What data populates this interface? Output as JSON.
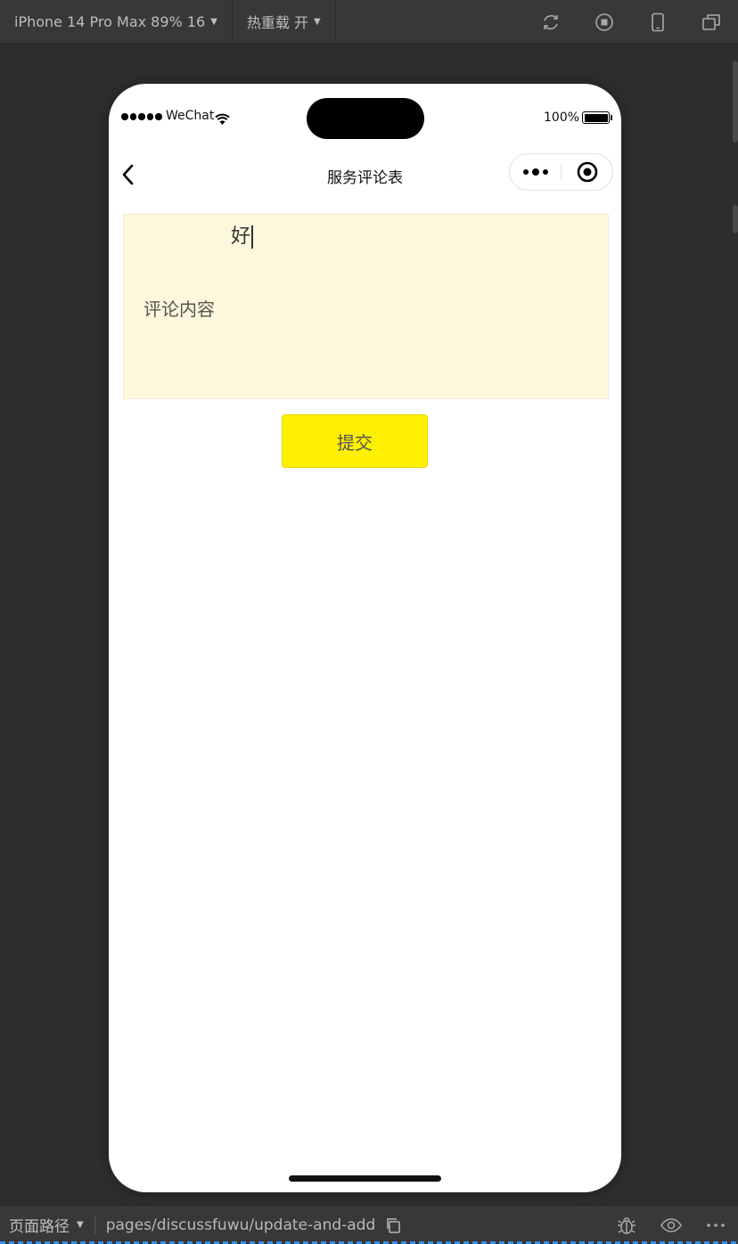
{
  "toolbar": {
    "device_label": "iPhone 14 Pro Max 89% 16",
    "hot_reload_label": "热重载 开",
    "icons": [
      "refresh-icon",
      "stop-icon",
      "phone-icon",
      "window-icon"
    ]
  },
  "phone": {
    "status": {
      "carrier": "WeChat",
      "battery": "100%"
    },
    "nav": {
      "title": "服务评论表"
    },
    "form": {
      "input_value": "好",
      "label": "评论内容"
    },
    "submit_label": "提交"
  },
  "bottom_bar": {
    "path_label": "页面路径",
    "page_path": "pages/discussfuwu/update-and-add"
  },
  "colors": {
    "button_bg": "#fff000",
    "form_bg": "#fdf8dc",
    "ide_bg": "#2e2e2e"
  }
}
